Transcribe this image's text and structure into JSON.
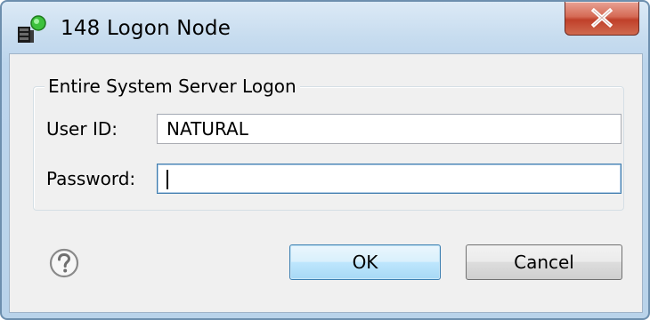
{
  "window": {
    "title": "148 Logon Node",
    "icon": "natural-node-icon",
    "close_icon": "close-icon"
  },
  "group": {
    "legend": "Entire System Server Logon"
  },
  "fields": {
    "user_id_label": "User ID:",
    "user_id_value": "NATURAL",
    "password_label": "Password:",
    "password_value": ""
  },
  "buttons": {
    "help_icon": "question-mark-icon",
    "ok_label": "OK",
    "cancel_label": "Cancel"
  },
  "colors": {
    "title_bar": "#c7dcef",
    "close_button": "#c7503b",
    "dialog_body": "#f0f0f0",
    "default_button": "#bee6fd",
    "focus_border": "#3d7bad"
  }
}
